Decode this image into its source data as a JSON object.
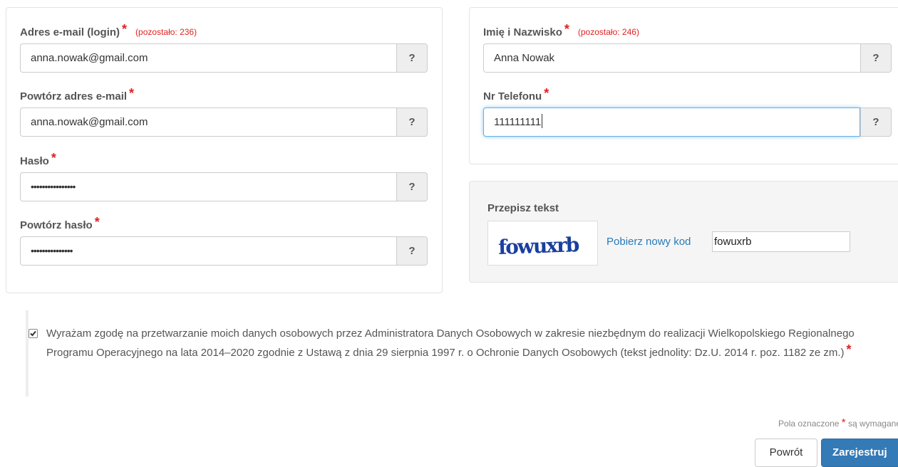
{
  "email": {
    "label": "Adres e-mail (login)",
    "remaining": "(pozostało: 236)",
    "value": "anna.nowak@gmail.com",
    "help": "?"
  },
  "email_repeat": {
    "label": "Powtórz adres e-mail",
    "value": "anna.nowak@gmail.com",
    "help": "?"
  },
  "password": {
    "label": "Hasło",
    "value": "••••••••••••••••",
    "help": "?"
  },
  "password_repeat": {
    "label": "Powtórz hasło",
    "value": "•••••••••••••••",
    "help": "?"
  },
  "name": {
    "label": "Imię i Nazwisko",
    "remaining": "(pozostało: 246)",
    "value": "Anna Nowak",
    "help": "?"
  },
  "phone": {
    "label": "Nr Telefonu",
    "value": "111111111",
    "help": "?"
  },
  "captcha": {
    "title": "Przepisz tekst",
    "image_text": "fowuxrb",
    "new_code_label": "Pobierz nowy kod",
    "input_value": "fowuxrb"
  },
  "consent": {
    "checked": true,
    "text": "Wyrażam zgodę na przetwarzanie moich danych osobowych przez Administratora Danych Osobowych w zakresie niezbędnym do realizacji Wielkopolskiego Regionalnego Programu Operacyjnego na lata 2014–2020 zgodnie z Ustawą z dnia 29 sierpnia 1997 r. o Ochronie Danych Osobowych (tekst jednolity: Dz.U. 2014 r. poz. 1182 ze zm.)"
  },
  "required_note": {
    "before": "Pola oznaczone",
    "star": "*",
    "after": "są wymagane"
  },
  "required_star": "*",
  "buttons": {
    "back": "Powrót",
    "register": "Zarejestruj"
  },
  "colors": {
    "required": "#e21f1f",
    "link": "#2a7ab8",
    "primary": "#337ab7",
    "captcha": "#1a3f9e"
  }
}
